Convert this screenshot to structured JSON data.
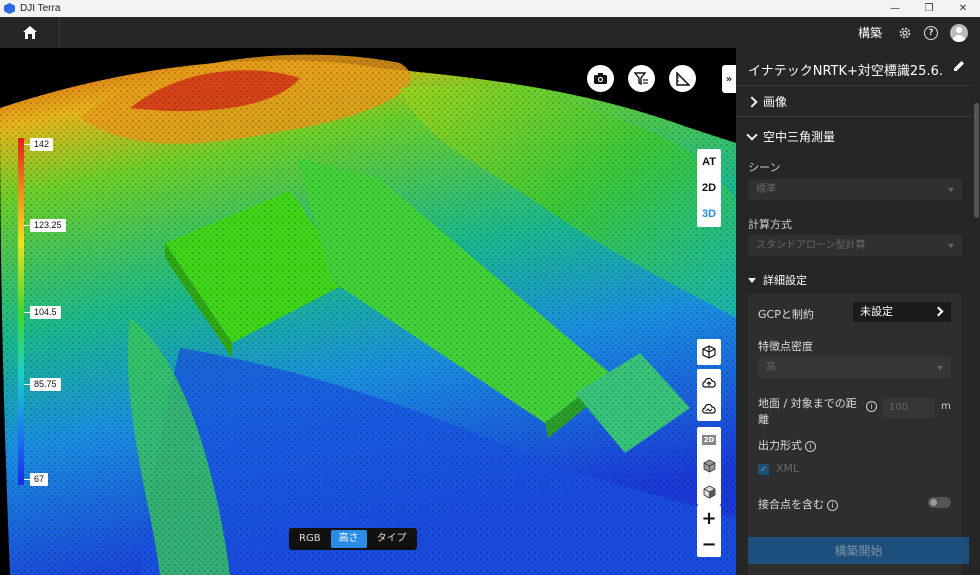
{
  "window": {
    "app_title": "DJI Terra",
    "minimize": "—",
    "maximize": "❐",
    "close": "✕"
  },
  "appbar": {
    "mode_label": "構築",
    "settings_icon": "gear-icon",
    "help_icon": "help-icon",
    "help_glyph": "?",
    "avatar_icon": "avatar"
  },
  "legend": {
    "values": [
      "142",
      "123.25",
      "104.5",
      "85.75",
      "67"
    ]
  },
  "viewport": {
    "collapse_glyph": "»",
    "view_modes": [
      {
        "label": "AT",
        "active": false
      },
      {
        "label": "2D",
        "active": false
      },
      {
        "label": "3D",
        "active": true
      }
    ],
    "color_modes": [
      {
        "label": "RGB",
        "active": false
      },
      {
        "label": "高さ",
        "active": true
      },
      {
        "label": "タイプ",
        "active": false
      }
    ],
    "zoom_in": "+",
    "zoom_out": "−",
    "tool_2d_label": "2D"
  },
  "panel": {
    "title": "イナテックNRTK+対空標識25.6.…",
    "images_section": "画像",
    "aerotriangulation_section": "空中三角測量",
    "scene_label": "シーン",
    "scene_value": "標準",
    "calc_method_label": "計算方式",
    "calc_method_value": "スタンドアローン型計算",
    "advanced_label": "詳細設定",
    "gcp_label": "GCPと制約",
    "gcp_value": "未設定",
    "feature_density_label": "特徴点密度",
    "feature_density_value": "高",
    "distance_label_line1": "地面 / 対象までの距",
    "distance_label_line2": "離",
    "distance_value": "100",
    "distance_unit": "m",
    "output_format_label": "出力形式",
    "output_format_value": "XML",
    "tie_points_label": "接合点を含む",
    "start_button": "構築開始",
    "info_glyph": "i",
    "check_glyph": "✓"
  }
}
